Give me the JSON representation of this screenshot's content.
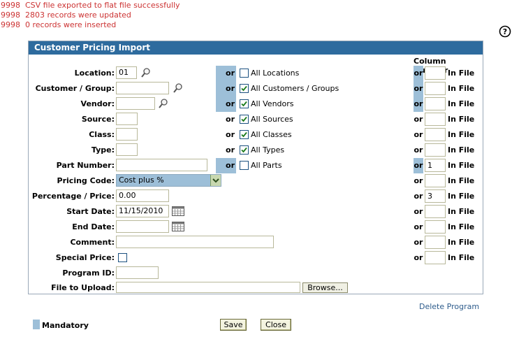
{
  "messages": [
    "9998  CSV file exported to flat file successfully",
    "9998  2803 records were updated",
    "9998  0 records were inserted"
  ],
  "panel": {
    "title": "Customer Pricing Import",
    "column_number_header": "Column Number"
  },
  "or_text": "or",
  "in_file_text": "In File",
  "fields": {
    "location": {
      "label": "Location:",
      "value": "01",
      "all_label": "All Locations",
      "all_checked": false,
      "col": ""
    },
    "customer_group": {
      "label": "Customer / Group:",
      "value": "",
      "all_label": "All Customers / Groups",
      "all_checked": true,
      "col": ""
    },
    "vendor": {
      "label": "Vendor:",
      "value": "",
      "all_label": "All Vendors",
      "all_checked": true,
      "col": ""
    },
    "source": {
      "label": "Source:",
      "value": "",
      "all_label": "All Sources",
      "all_checked": true,
      "col": ""
    },
    "class": {
      "label": "Class:",
      "value": "",
      "all_label": "All Classes",
      "all_checked": true,
      "col": ""
    },
    "type": {
      "label": "Type:",
      "value": "",
      "all_label": "All Types",
      "all_checked": true,
      "col": ""
    },
    "part_number": {
      "label": "Part Number:",
      "value": "",
      "all_label": "All Parts",
      "all_checked": false,
      "col": "1"
    },
    "pricing_code": {
      "label": "Pricing Code:",
      "value": "Cost plus %",
      "col": ""
    },
    "percentage_price": {
      "label": "Percentage / Price:",
      "value": "0.00",
      "col": "3"
    },
    "start_date": {
      "label": "Start Date:",
      "value": "11/15/2010",
      "col": ""
    },
    "end_date": {
      "label": "End Date:",
      "value": "",
      "col": ""
    },
    "comment": {
      "label": "Comment:",
      "value": "",
      "col": ""
    },
    "special_price": {
      "label": "Special Price:",
      "checked": false,
      "col": ""
    },
    "program_id": {
      "label": "Program ID:",
      "value": ""
    },
    "file_upload": {
      "label": "File to Upload:",
      "value": "",
      "browse_label": "Browse..."
    }
  },
  "footer": {
    "delete_program": "Delete Program",
    "mandatory_legend": "Mandatory",
    "save_label": "Save",
    "close_label": "Close"
  },
  "colors": {
    "header_bg": "#2e6b9e",
    "mandatory": "#9dbfd8",
    "message": "#cc3333",
    "link": "#2e5c8c"
  },
  "icons": {
    "help": "help-icon",
    "lookup": "magnifier-icon",
    "calendar": "calendar-icon"
  }
}
